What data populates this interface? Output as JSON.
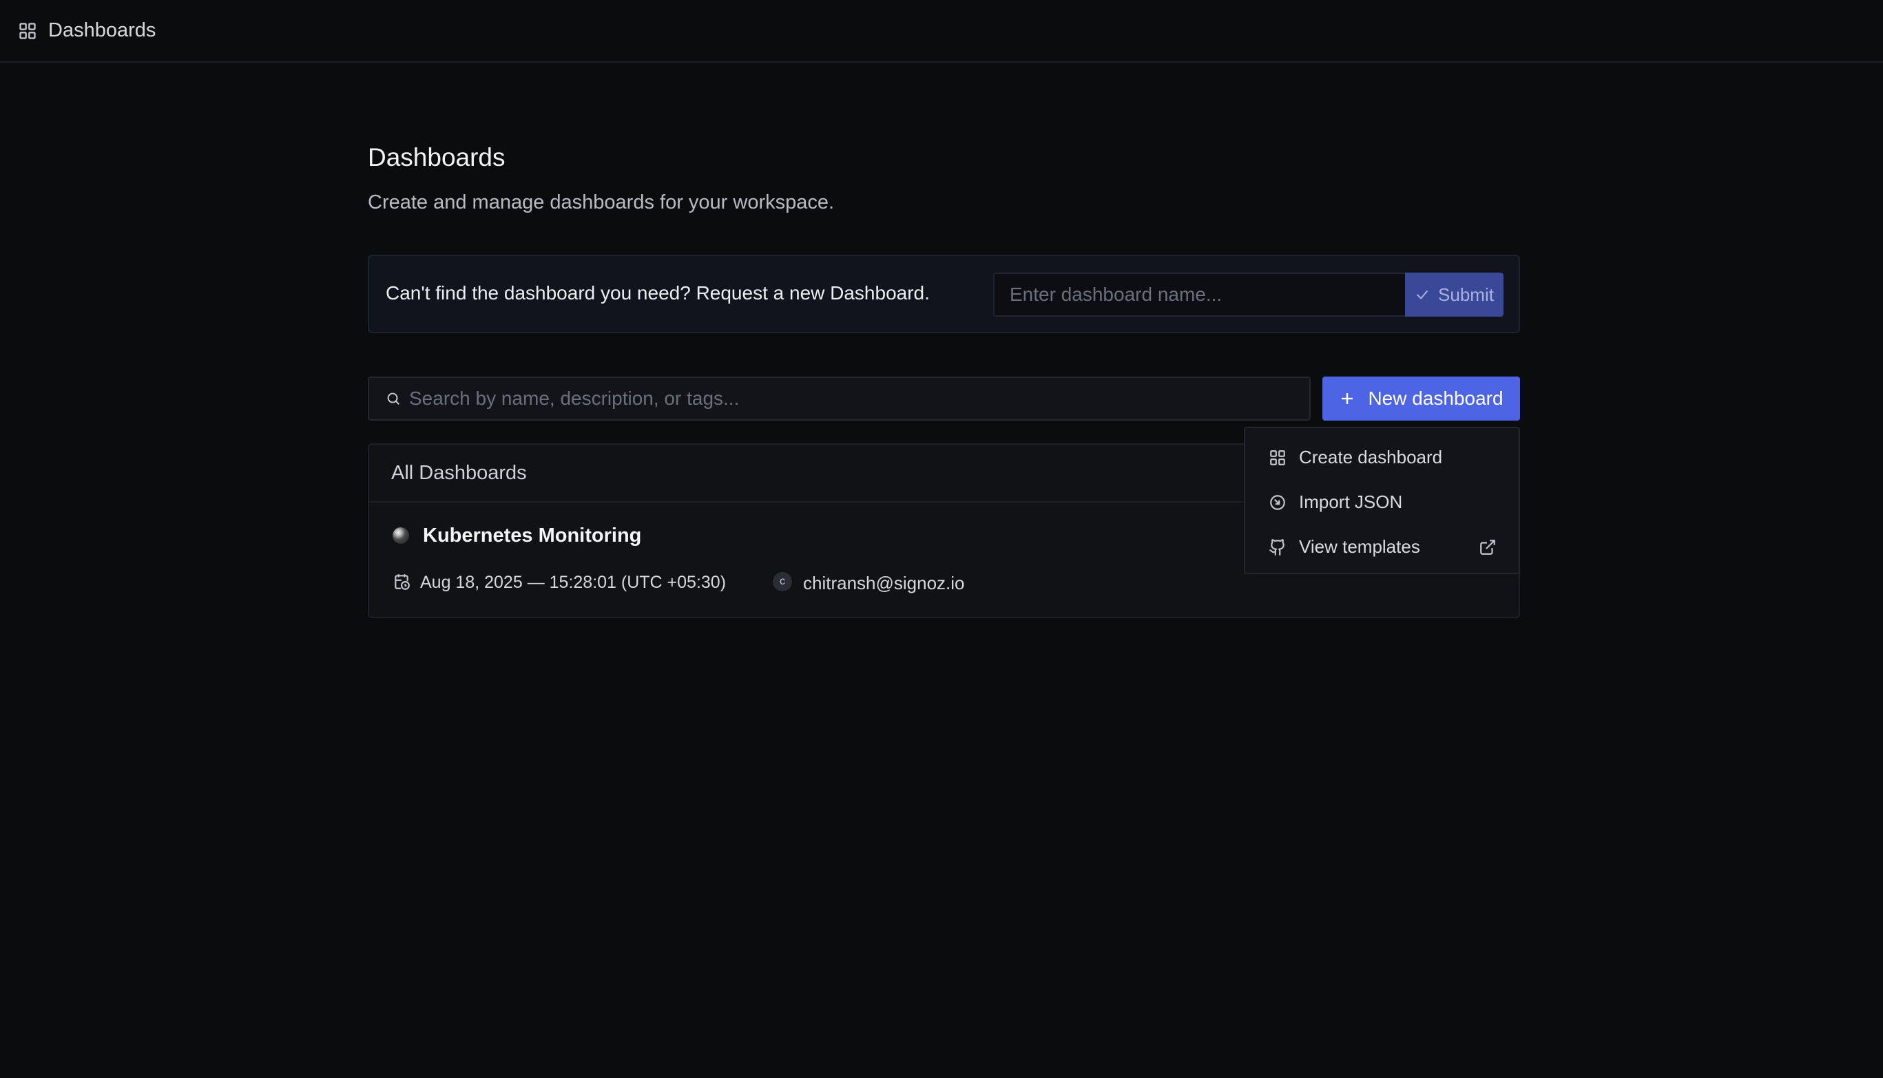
{
  "topbar": {
    "icon": "grid-icon",
    "title": "Dashboards"
  },
  "page": {
    "title": "Dashboards",
    "subtitle": "Create and manage dashboards for your workspace."
  },
  "request": {
    "message": "Can't find the dashboard you need? Request a new Dashboard.",
    "input_placeholder": "Enter dashboard name...",
    "input_value": "",
    "submit_label": "Submit"
  },
  "search": {
    "placeholder": "Search by name, description, or tags...",
    "value": ""
  },
  "new_dashboard": {
    "label": "New dashboard"
  },
  "list": {
    "header": "All Dashboards",
    "items": [
      {
        "name": "Kubernetes Monitoring",
        "created_at": "Aug 18, 2025 — 15:28:01 (UTC +05:30)",
        "author_initial": "c",
        "author": "chitransh@signoz.io"
      }
    ]
  },
  "menu": {
    "items": [
      {
        "label": "Create dashboard",
        "icon": "grid-icon"
      },
      {
        "label": "Import JSON",
        "icon": "import-icon"
      },
      {
        "label": "View templates",
        "icon": "github-icon",
        "trailing_icon": "external-link-icon"
      }
    ]
  },
  "colors": {
    "background": "#0b0c0e",
    "primary": "#4d64e4",
    "submit_disabled": "#3a4898",
    "panel": "#101216",
    "border": "#1d2026"
  }
}
